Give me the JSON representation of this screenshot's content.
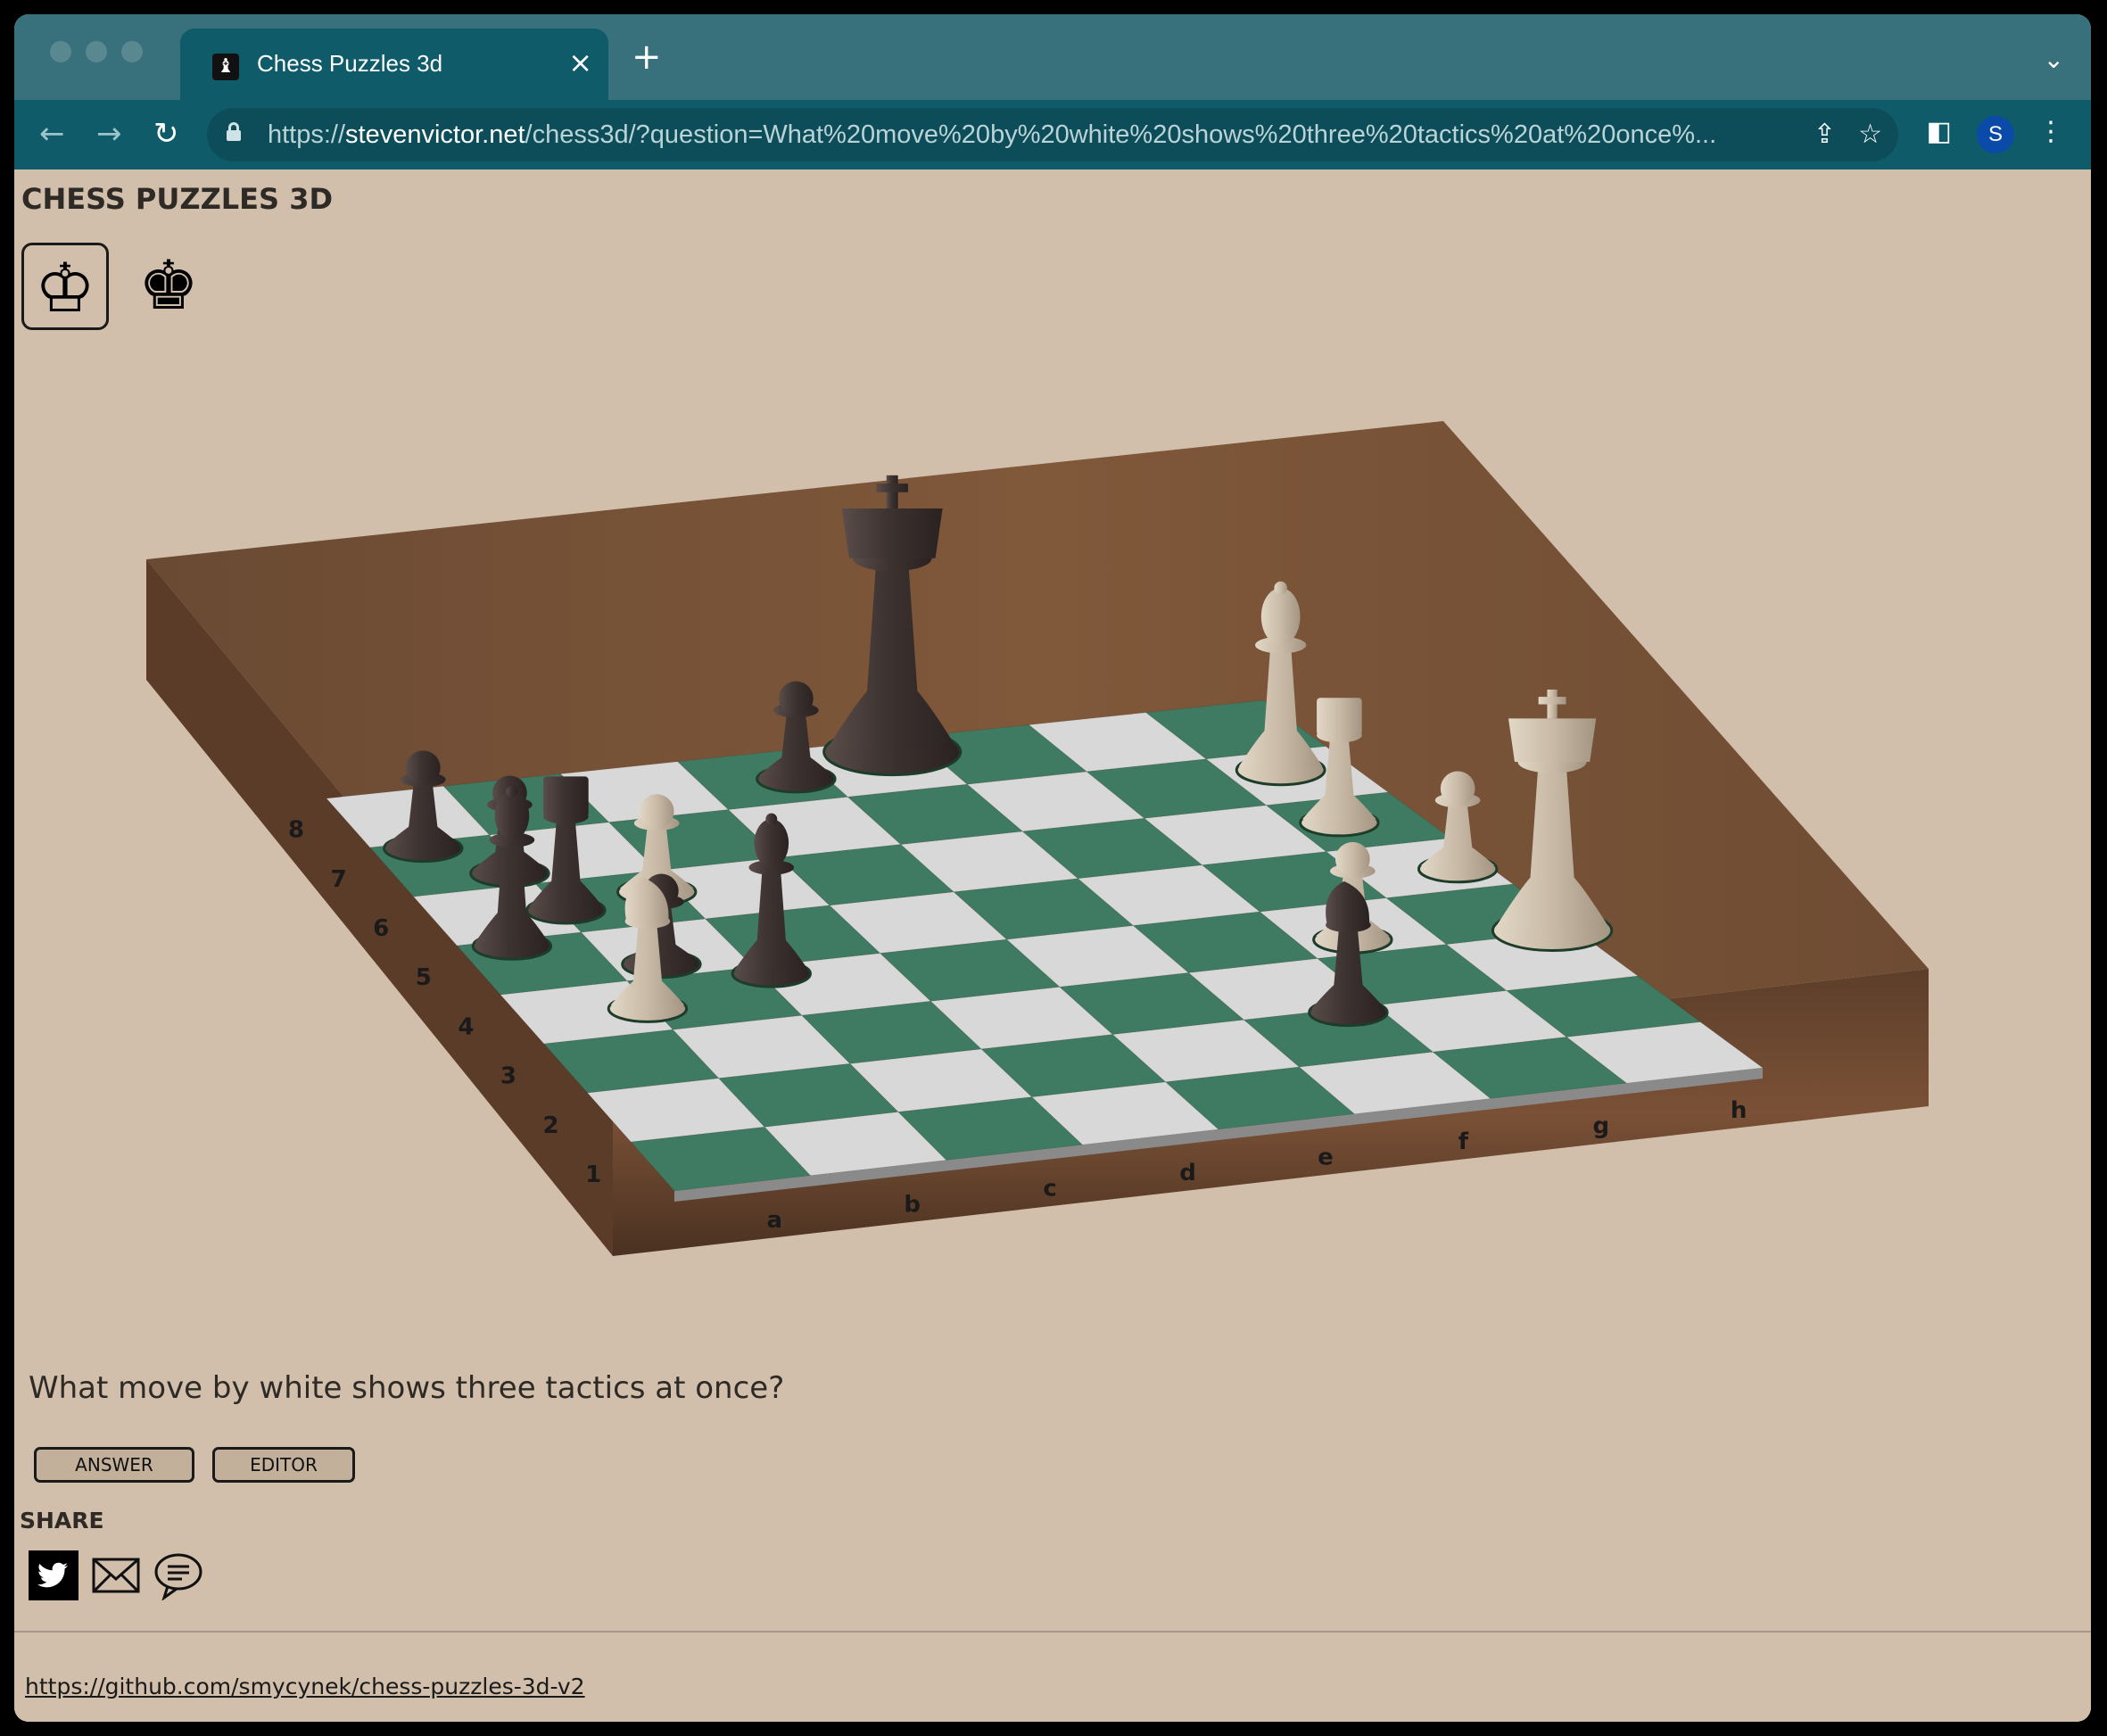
{
  "browser": {
    "tab_title": "Chess Puzzles 3d",
    "tab_close": "×",
    "new_tab": "+",
    "url_prefix": "https://",
    "url_host": "stevenvictor.net",
    "url_rest": "/chess3d/?question=What%20move%20by%20white%20shows%20three%20tactics%20at%20once%...",
    "profile_initial": "S"
  },
  "page": {
    "title": "CHESS PUZZLES 3D",
    "white_side_glyph": "♔",
    "black_side_glyph": "♚",
    "question": "What move by white shows three tactics at once?",
    "answer_button": "ANSWER",
    "editor_button": "EDITOR",
    "share_label": "SHARE",
    "footer_link": "https://github.com/smycynek/chess-puzzles-3d-v2"
  },
  "board": {
    "files": [
      "a",
      "b",
      "c",
      "d",
      "e",
      "f",
      "g",
      "h"
    ],
    "ranks": [
      "1",
      "2",
      "3",
      "4",
      "5",
      "6",
      "7",
      "8"
    ],
    "pieces": [
      {
        "color": "black",
        "type": "king"
      },
      {
        "color": "black",
        "type": "pawn"
      },
      {
        "color": "black",
        "type": "pawn"
      },
      {
        "color": "black",
        "type": "pawn"
      },
      {
        "color": "black",
        "type": "pawn"
      },
      {
        "color": "black",
        "type": "rook"
      },
      {
        "color": "black",
        "type": "bishop"
      },
      {
        "color": "black",
        "type": "bishop"
      },
      {
        "color": "black",
        "type": "knight"
      },
      {
        "color": "white",
        "type": "pawn"
      },
      {
        "color": "white",
        "type": "knight"
      },
      {
        "color": "white",
        "type": "bishop"
      },
      {
        "color": "white",
        "type": "rook"
      },
      {
        "color": "white",
        "type": "pawn"
      },
      {
        "color": "white",
        "type": "pawn"
      },
      {
        "color": "white",
        "type": "king"
      }
    ]
  },
  "colors": {
    "page_bg": "#d2bfab",
    "tab_strip": "#38707b",
    "toolbar": "#0f5b6a",
    "light_square": "#d8d8d8",
    "dark_square": "#3f7a62",
    "board_wood": "#6b4a32",
    "black_piece": "#3f3533",
    "white_piece": "#c8baa6"
  }
}
